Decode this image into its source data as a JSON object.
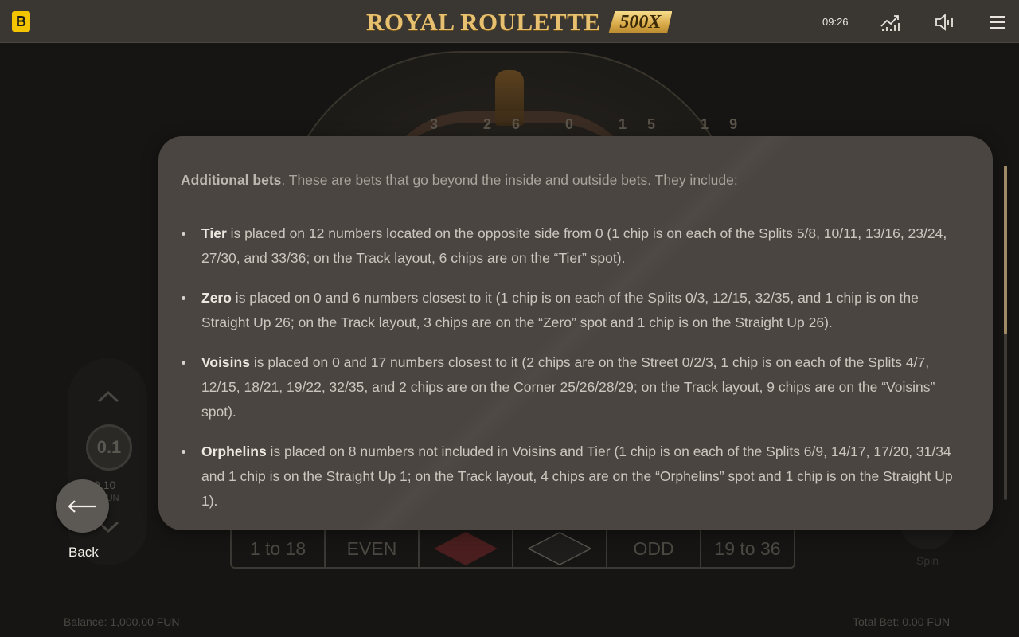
{
  "header": {
    "brand_letter": "B",
    "title": "ROYAL ROULETTE",
    "title_badge": "500X",
    "clock": "09:26",
    "icons": [
      "stats-icon",
      "sound-icon",
      "menu-icon"
    ]
  },
  "background": {
    "wheel_numbers": "3 26 0 15 19",
    "chip_value_display": "0.1",
    "chip_value": "0.10",
    "chip_currency": "FUN",
    "bet_cells": [
      "1 to 18",
      "EVEN",
      "",
      "",
      "ODD",
      "19 to 36"
    ],
    "spin_label": "Spin",
    "balance": "Balance: 1,000.00 FUN",
    "total_bet": "Total Bet: 0.00 FUN"
  },
  "modal": {
    "intro_title": "Additional bets",
    "intro_text": ". These are bets that go beyond the inside and outside bets. They include:",
    "items": [
      {
        "name": "Tier",
        "text": " is placed on 12 numbers located on the opposite side from 0 (1 chip is on each of the Splits 5/8, 10/11, 13/16, 23/24, 27/30, and 33/36; on the Track layout, 6 chips are on the “Tier” spot)."
      },
      {
        "name": "Zero",
        "text": " is placed on 0 and 6 numbers closest to it (1 chip is on each of the Splits 0/3, 12/15, 32/35, and 1 chip is on the Straight Up 26; on the Track layout, 3 chips are on the “Zero” spot and 1 chip is on the Straight Up 26)."
      },
      {
        "name": "Voisins",
        "text": " is placed on 0 and 17 numbers closest to it (2 chips are on the Street 0/2/3, 1 chip is on each of the Splits 4/7, 12/15, 18/21, 19/22, 32/35, and 2 chips are on the Corner 25/26/28/29; on the Track layout, 9 chips are on the “Voisins” spot)."
      },
      {
        "name": "Orphelins",
        "text": " is placed on 8 numbers not included in Voisins and Tier (1 chip is on each of the Splits 6/9, 14/17, 17/20, 31/34 and 1 chip is on the Straight Up 1; on the Track layout, 4 chips are on the “Orphelins” spot and 1 chip is on the Straight Up 1)."
      }
    ]
  },
  "back_button": {
    "label": "Back"
  },
  "colors": {
    "header_bg": "#3a3733",
    "brand_yellow": "#f5c400",
    "title_gold": "#e8c170",
    "modal_bg": "#4a4540",
    "scroll_thumb": "#a08a66"
  }
}
